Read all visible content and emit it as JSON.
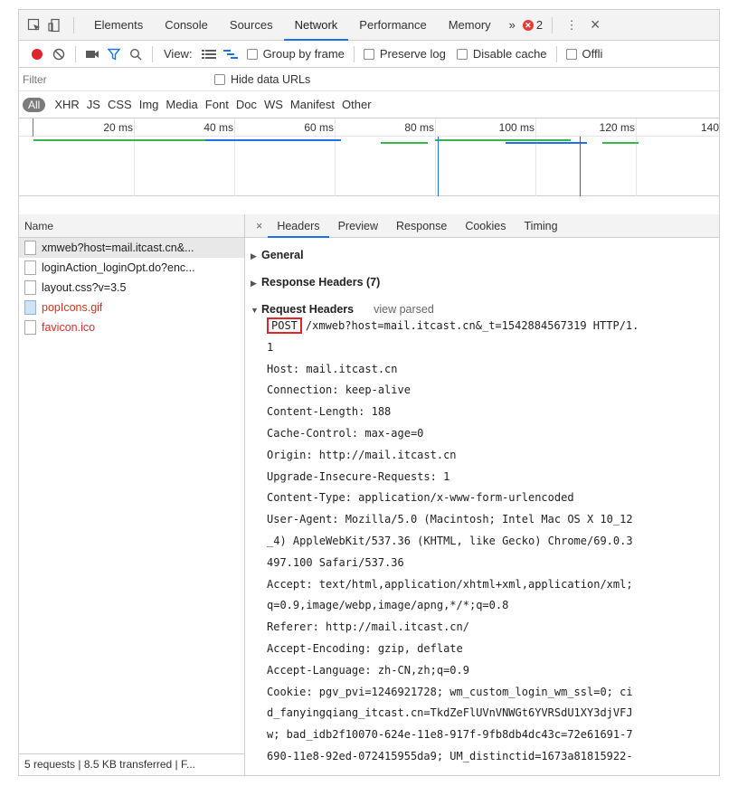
{
  "tabs": {
    "items": [
      "Elements",
      "Console",
      "Sources",
      "Network",
      "Performance",
      "Memory"
    ],
    "more": "»",
    "error_count": "2",
    "kebab": "⋮",
    "close": "×"
  },
  "toolbar": {
    "view_label": "View:",
    "group_by_frame": "Group by frame",
    "preserve_log": "Preserve log",
    "disable_cache": "Disable cache",
    "offline": "Offli"
  },
  "filter": {
    "placeholder": "Filter",
    "hide_data_urls": "Hide data URLs"
  },
  "types": {
    "all": "All",
    "items": [
      "XHR",
      "JS",
      "CSS",
      "Img",
      "Media",
      "Font",
      "Doc",
      "WS",
      "Manifest",
      "Other"
    ]
  },
  "timeline": {
    "ticks": [
      "20 ms",
      "40 ms",
      "60 ms",
      "80 ms",
      "100 ms",
      "120 ms",
      "140"
    ]
  },
  "requests": {
    "header": "Name",
    "items": [
      {
        "name": "xmweb?host=mail.itcast.cn&...",
        "error": false,
        "image": false
      },
      {
        "name": "loginAction_loginOpt.do?enc...",
        "error": false,
        "image": false
      },
      {
        "name": "layout.css?v=3.5",
        "error": false,
        "image": false
      },
      {
        "name": "popIcons.gif",
        "error": true,
        "image": true
      },
      {
        "name": "favicon.ico",
        "error": true,
        "image": false
      }
    ],
    "status": "5 requests | 8.5 KB transferred | F..."
  },
  "detail": {
    "close": "×",
    "tabs": [
      "Headers",
      "Preview",
      "Response",
      "Cookies",
      "Timing"
    ],
    "general": "General",
    "response_headers": "Response Headers (7)",
    "request_headers": "Request Headers",
    "view_parsed": "view parsed",
    "method": "POST",
    "request_line_rest": "/xmweb?host=mail.itcast.cn&_t=1542884567319 HTTP/1.",
    "lines": [
      "1",
      "Host: mail.itcast.cn",
      "Connection: keep-alive",
      "Content-Length: 188",
      "Cache-Control: max-age=0",
      "Origin: http://mail.itcast.cn",
      "Upgrade-Insecure-Requests: 1",
      "Content-Type: application/x-www-form-urlencoded",
      "User-Agent: Mozilla/5.0 (Macintosh; Intel Mac OS X 10_12",
      "_4) AppleWebKit/537.36 (KHTML, like Gecko) Chrome/69.0.3",
      "497.100 Safari/537.36",
      "Accept: text/html,application/xhtml+xml,application/xml;",
      "q=0.9,image/webp,image/apng,*/*;q=0.8",
      "Referer: http://mail.itcast.cn/",
      "Accept-Encoding: gzip, deflate",
      "Accept-Language: zh-CN,zh;q=0.9",
      "Cookie: pgv_pvi=1246921728; wm_custom_login_wm_ssl=0; ci",
      "d_fanyingqiang_itcast.cn=TkdZeFlUVnVNWGt6YVRSdU1XY3djVFJ",
      "w; bad_idb2f10070-624e-11e8-917f-9fb8db4dc43c=72e61691-7",
      "690-11e8-92ed-072415955da9; UM_distinctid=1673a81815922-"
    ]
  },
  "colors": {
    "accent": "#1a73e8",
    "record": "#e0242b",
    "error_text": "#d93025"
  }
}
